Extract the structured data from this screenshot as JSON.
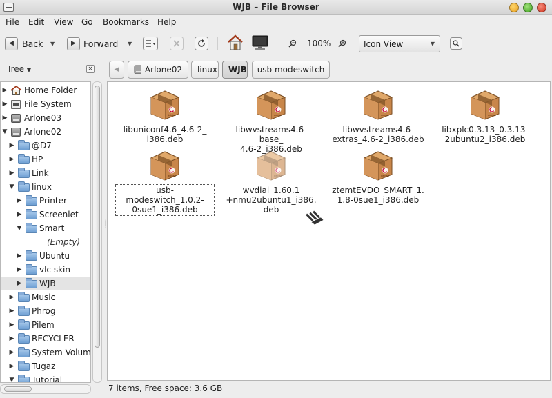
{
  "window": {
    "title": "WJB – File Browser"
  },
  "menubar": [
    "File",
    "Edit",
    "View",
    "Go",
    "Bookmarks",
    "Help"
  ],
  "toolbar": {
    "back_label": "Back",
    "forward_label": "Forward",
    "zoom_level": "100%",
    "view_mode": "Icon View",
    "icons": [
      "back-arrow-icon",
      "forward-arrow-icon",
      "location-icon",
      "stop-icon",
      "reload-icon",
      "home-icon",
      "computer-icon",
      "zoom-out-icon",
      "zoom-in-icon",
      "search-icon"
    ]
  },
  "sidebar": {
    "title": "Tree",
    "items": [
      {
        "label": "Home Folder",
        "icon": "home-icon",
        "expanded": false
      },
      {
        "label": "File System",
        "icon": "filesystem-icon",
        "expanded": false
      },
      {
        "label": "Arlone03",
        "icon": "drive-icon",
        "expanded": false
      },
      {
        "label": "Arlone02",
        "icon": "drive-icon",
        "expanded": true
      },
      {
        "label": "@D7",
        "icon": "folder-icon",
        "expanded": false
      },
      {
        "label": "HP",
        "icon": "folder-icon",
        "expanded": false
      },
      {
        "label": "Link",
        "icon": "folder-icon",
        "expanded": false
      },
      {
        "label": "linux",
        "icon": "folder-icon",
        "expanded": true
      },
      {
        "label": "Printer",
        "icon": "folder-icon",
        "expanded": false
      },
      {
        "label": "Screenlet",
        "icon": "folder-icon",
        "expanded": false
      },
      {
        "label": "Smart",
        "icon": "folder-icon",
        "expanded": true
      },
      {
        "label": "(Empty)",
        "icon": "",
        "expanded": false
      },
      {
        "label": "Ubuntu",
        "icon": "folder-icon",
        "expanded": false
      },
      {
        "label": "vlc skin",
        "icon": "folder-icon",
        "expanded": false
      },
      {
        "label": "WJB",
        "icon": "folder-icon",
        "expanded": false
      },
      {
        "label": "Music",
        "icon": "folder-icon",
        "expanded": false
      },
      {
        "label": "Phrog",
        "icon": "folder-icon",
        "expanded": false
      },
      {
        "label": "Pilem",
        "icon": "folder-icon",
        "expanded": false
      },
      {
        "label": "RECYCLER",
        "icon": "folder-icon",
        "expanded": false
      },
      {
        "label": "System Volume",
        "icon": "folder-icon",
        "expanded": false
      },
      {
        "label": "Tugaz",
        "icon": "folder-icon",
        "expanded": false
      },
      {
        "label": "Tutorial",
        "icon": "folder-icon",
        "expanded": true
      }
    ]
  },
  "pathbar": {
    "crumbs": [
      "Arlone02",
      "linux",
      "WJB",
      "usb modeswitch"
    ],
    "active": "WJB"
  },
  "files": [
    {
      "name": "libuniconf4.6_4.6-2_i386.deb",
      "lines": [
        "libuniconf4.6_4.6-2_",
        "i386.deb"
      ]
    },
    {
      "name": "libwvstreams4.6-base_4.6-2_i386.deb",
      "lines": [
        "libwvstreams4.6-base_",
        "4.6-2_i386.deb"
      ]
    },
    {
      "name": "libwvstreams4.6-extras_4.6-2_i386.deb",
      "lines": [
        "libwvstreams4.6-",
        "extras_4.6-2_i386.deb"
      ]
    },
    {
      "name": "libxplc0.3.13_0.3.13-2ubuntu2_i386.deb",
      "lines": [
        "libxplc0.3.13_0.3.13-",
        "2ubuntu2_i386.deb"
      ]
    },
    {
      "name": "usb-modeswitch_1.0.2-0sue1_i386.deb",
      "lines": [
        "usb-modeswitch_1.0.2-",
        "0sue1_i386.deb"
      ]
    },
    {
      "name": "wvdial_1.60.1+nmu2ubuntu1_i386.deb",
      "lines": [
        "wvdial_1.60.1",
        "+nmu2ubuntu1_i386.",
        "deb"
      ]
    },
    {
      "name": "ztemtEVDO_SMART_1.1.8-0sue1_i386.deb",
      "lines": [
        "ztemtEVDO_SMART_1.",
        "1.8-0sue1_i386.deb"
      ]
    }
  ],
  "status": {
    "text": "7 items, Free space: 3.6 GB"
  },
  "colors": {
    "package_box": "#c8864a",
    "package_tape": "#8a5a2c",
    "debian_red": "#c70036",
    "folder_blue": "#6e9fd3"
  }
}
